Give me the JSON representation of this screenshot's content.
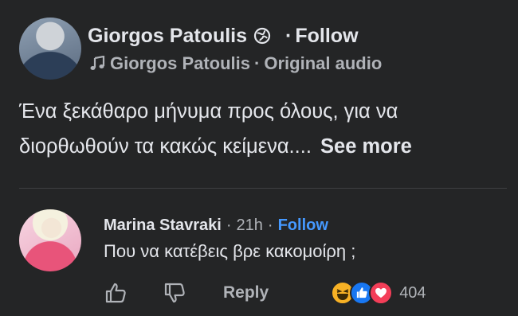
{
  "post": {
    "author_name": "Giorgos Patoulis",
    "separator": "·",
    "follow_label": "Follow",
    "audio_author": "Giorgos Patoulis",
    "audio_sep": "·",
    "audio_label": "Original audio",
    "caption": "Ένα ξεκάθαρο μήνυμα προς όλους, για να διορθωθούν τα κακώς κείμενα....",
    "see_more_label": "See more",
    "icons": [
      "globe-icon",
      "music-note-icon"
    ]
  },
  "comment": {
    "author": "Marina Stavraki",
    "separator": "·",
    "time": "21h",
    "follow_separator": "·",
    "follow_label": "Follow",
    "text": "Που να κατέβεις βρε κακομοίρη ;",
    "reply_label": "Reply",
    "reaction_count": "404",
    "reactions": [
      "haha",
      "like",
      "love"
    ]
  },
  "colors": {
    "background": "#242526",
    "text": "#e4e6eb",
    "secondary": "#b0b3b8",
    "link_blue": "#4599ff",
    "like_blue": "#1877f2",
    "love_red": "#f33e58",
    "haha_yellow": "#f7b125"
  }
}
